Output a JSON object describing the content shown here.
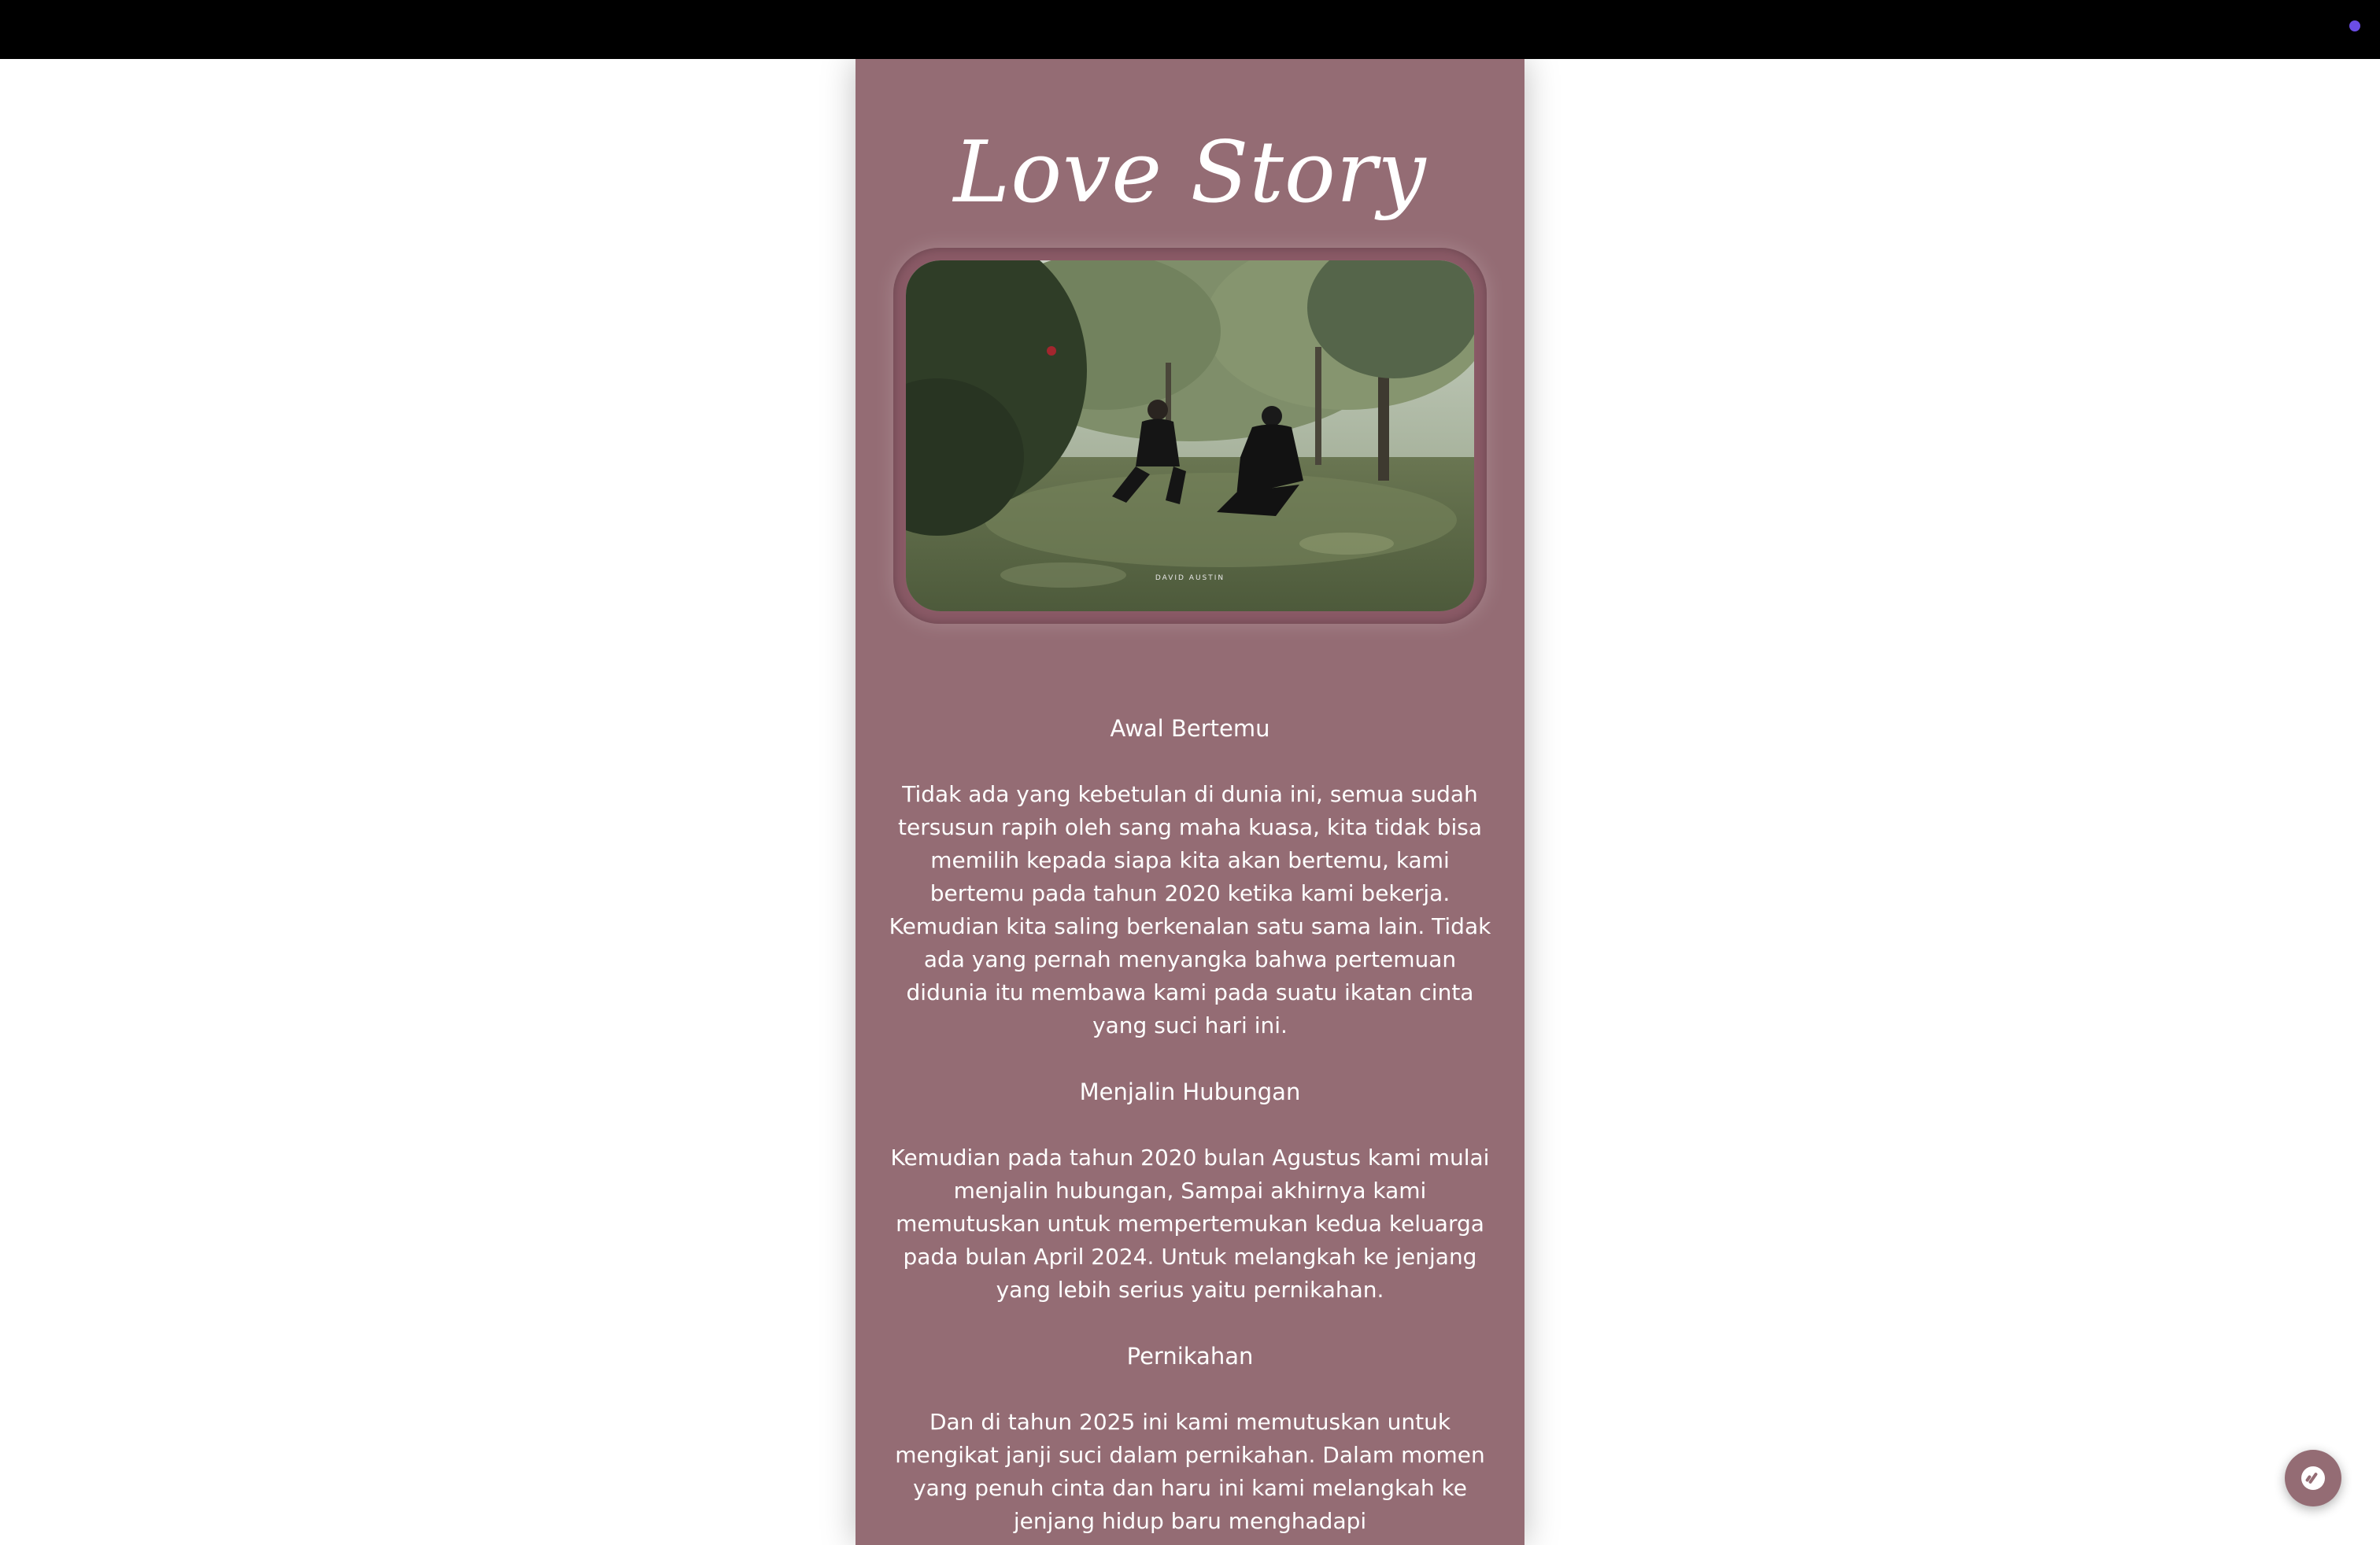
{
  "theme": {
    "panel_color": "#946c74",
    "topbar_color": "#000000",
    "indicator_color": "#6b4de6"
  },
  "header": {
    "title": "Love Story"
  },
  "photo": {
    "watermark": "DAVID AUSTIN"
  },
  "sections": [
    {
      "heading": "Awal Bertemu",
      "body": "Tidak ada yang kebetulan di dunia ini, semua sudah tersusun rapih oleh sang maha kuasa, kita tidak bisa memilih kepada siapa kita akan bertemu, kami bertemu pada tahun 2020 ketika kami bekerja. Kemudian kita saling berkenalan satu sama lain. Tidak ada yang pernah menyangka bahwa pertemuan didunia itu membawa kami pada suatu ikatan cinta yang suci hari ini."
    },
    {
      "heading": "Menjalin Hubungan",
      "body": "Kemudian pada tahun 2020 bulan Agustus kami mulai menjalin hubungan, Sampai akhirnya kami memutuskan untuk mempertemukan kedua keluarga pada bulan April 2024. Untuk melangkah ke jenjang yang lebih serius yaitu pernikahan."
    },
    {
      "heading": "Pernikahan",
      "body": "Dan di tahun 2025 ini kami memutuskan untuk mengikat janji suci dalam pernikahan. Dalam momen yang penuh cinta dan haru ini kami melangkah ke jenjang hidup baru menghadapi"
    }
  ],
  "fab": {
    "icon": "music-disc-icon"
  }
}
